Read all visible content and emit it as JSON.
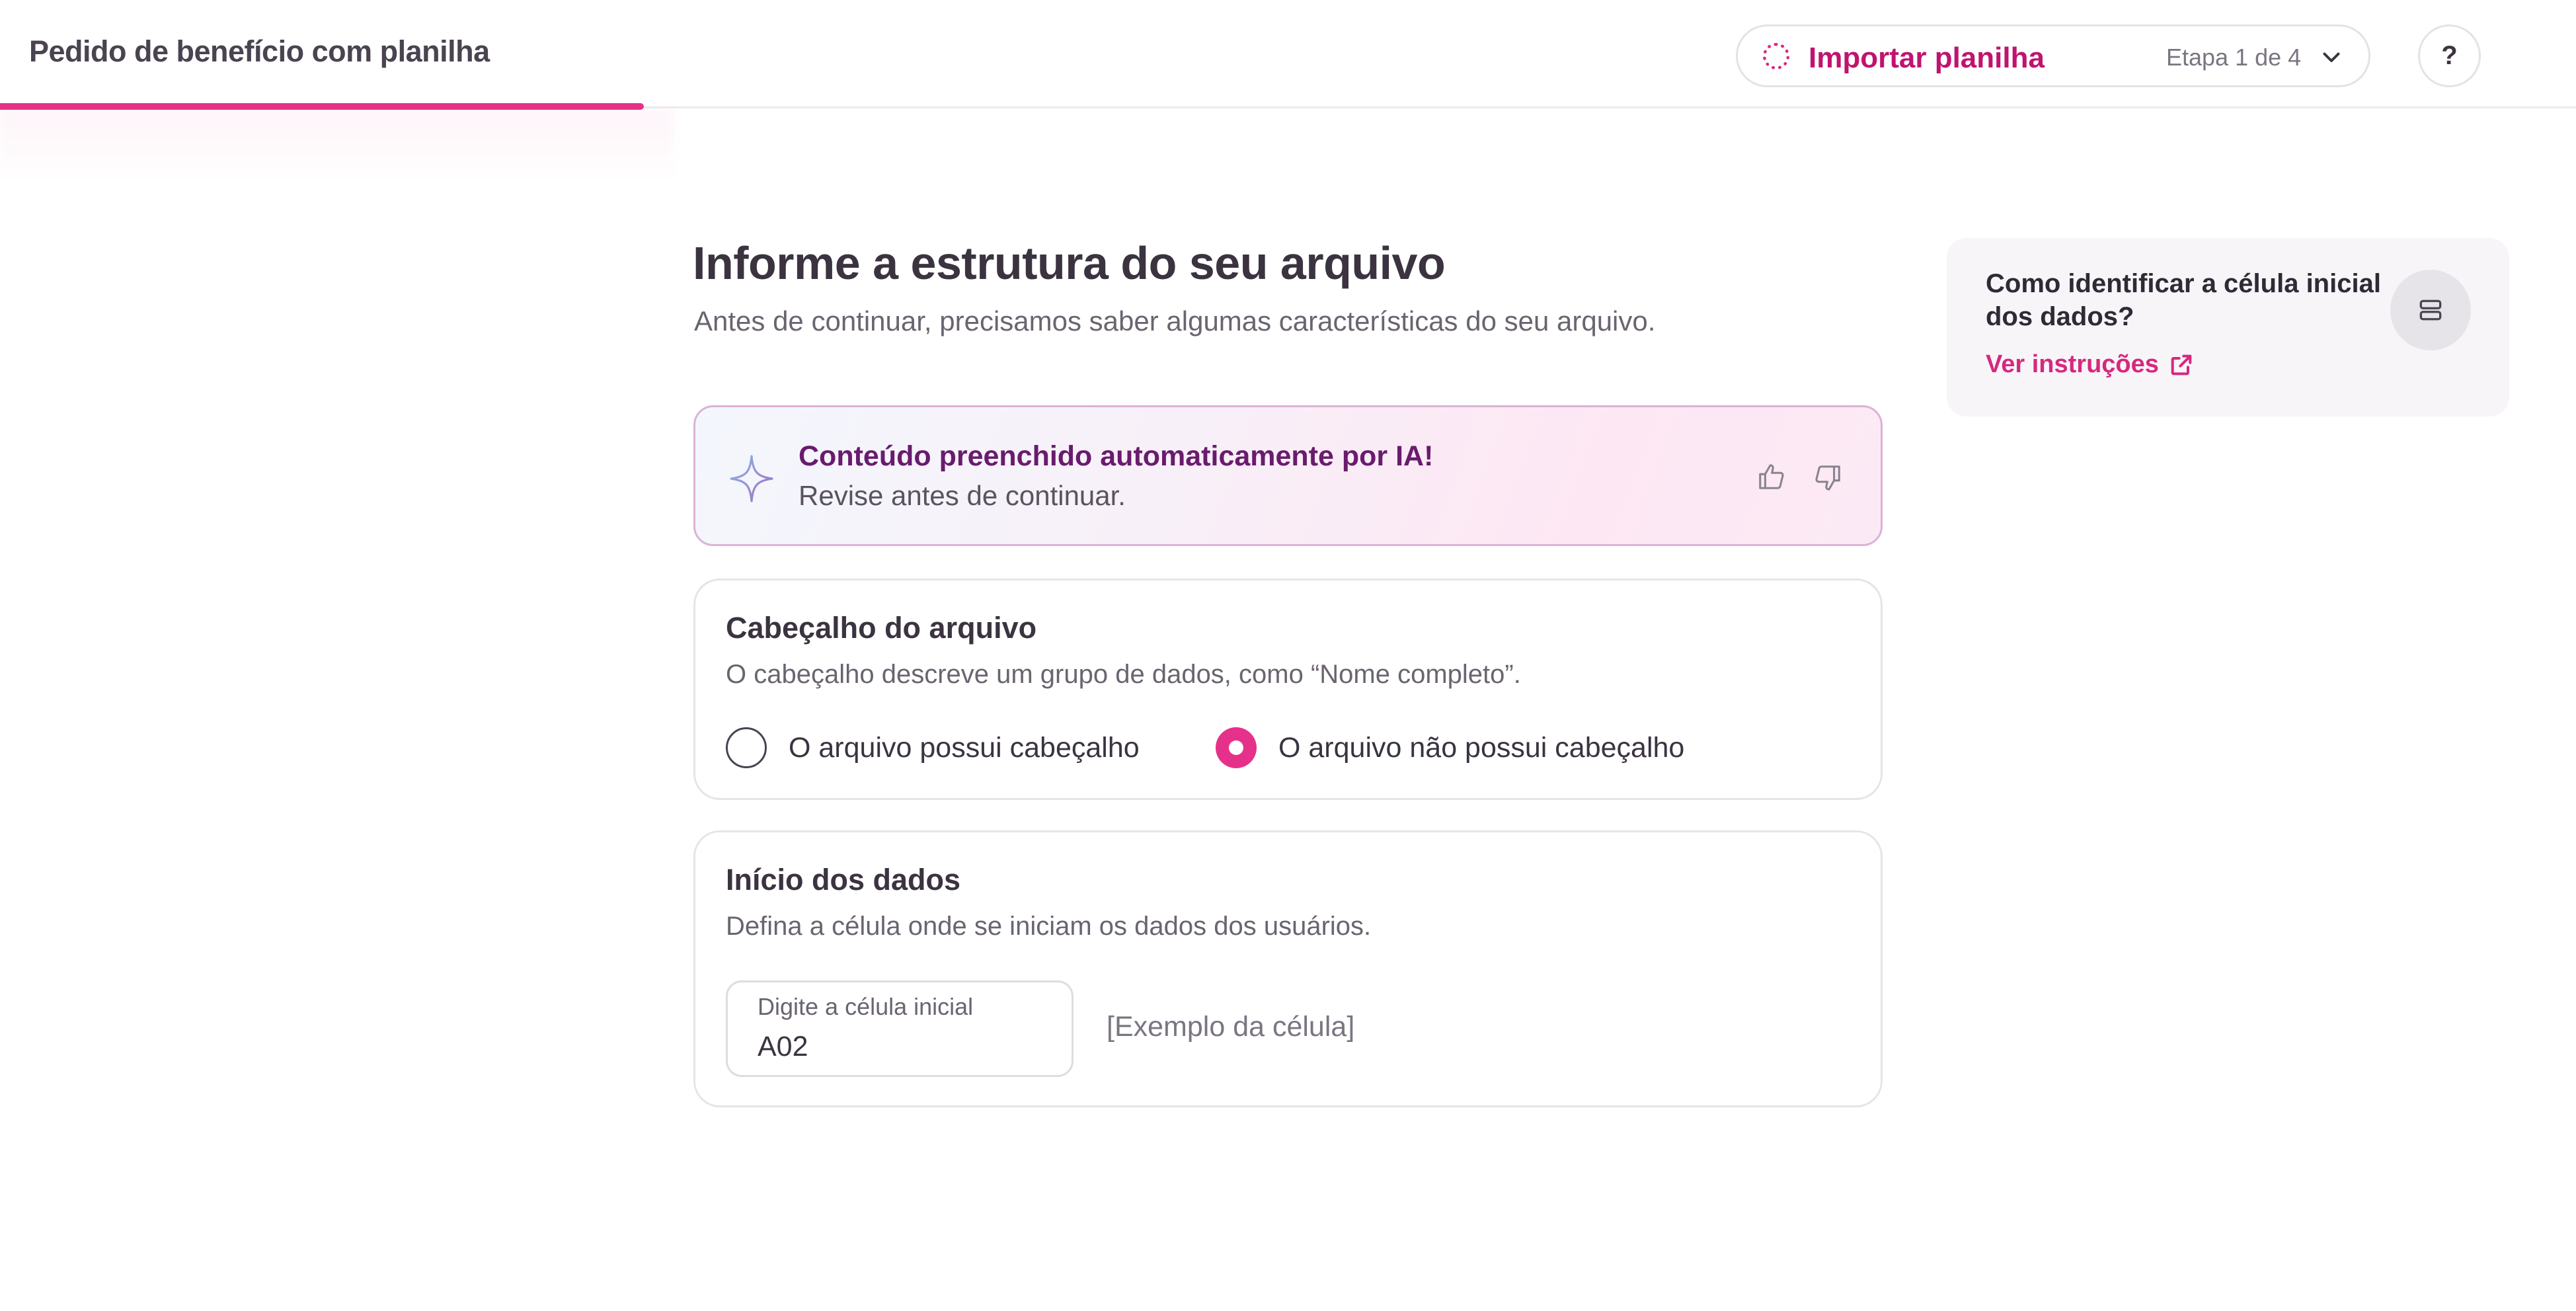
{
  "app": {
    "title": "Pedido de benefício com planilha",
    "progress_fraction": 0.25
  },
  "stepper": {
    "current_step": "Importar planilha",
    "counter": "Etapa 1 de 4",
    "icon": "chevron-down-icon"
  },
  "help": {
    "label": "?"
  },
  "main": {
    "title": "Informe a estrutura do seu arquivo",
    "subtitle": "Antes de continuar, precisamos saber algumas características do seu arquivo."
  },
  "ai_banner": {
    "title": "Conteúdo preenchido automaticamente por IA!",
    "text": "Revise antes de continuar.",
    "icons": [
      "sparkle-icon",
      "thumbs-up-icon",
      "thumbs-down-icon"
    ]
  },
  "header_section": {
    "title": "Cabeçalho do arquivo",
    "description": "O cabeçalho descreve um grupo de dados, como “Nome completo”.",
    "options": [
      {
        "label": "O arquivo possui cabeçalho",
        "selected": false
      },
      {
        "label": "O arquivo não possui cabeçalho",
        "selected": true
      }
    ]
  },
  "data_start_section": {
    "title": "Início dos dados",
    "description": "Defina a célula onde se iniciam os dados dos usuários.",
    "field_label": "Digite a célula inicial",
    "field_value": "A02",
    "example": "[Exemplo da célula]"
  },
  "help_card": {
    "title": "Como identificar a célula inicial dos dados?",
    "link": "Ver instruções",
    "icon": "table-rows-icon"
  },
  "colors": {
    "accent": "#e6318a",
    "accent_dark": "#c0136f",
    "ai_title": "#6a1b6e",
    "text": "#3b3340"
  }
}
